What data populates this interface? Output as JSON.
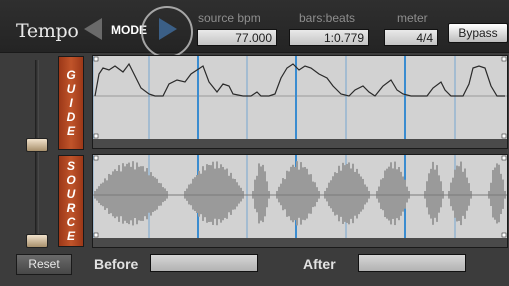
{
  "header": {
    "title": "Tempo",
    "mode_label": "MODE",
    "bypass_label": "Bypass"
  },
  "fields": {
    "source_bpm": {
      "label": "source bpm",
      "value": "77.000"
    },
    "bars_beats": {
      "label": "bars:beats",
      "value": "1:0.779"
    },
    "meter": {
      "label": "meter",
      "value": "4/4"
    }
  },
  "side_labels": {
    "guide": [
      "G",
      "U",
      "I",
      "D",
      "E"
    ],
    "source": [
      "S",
      "O",
      "U",
      "R",
      "C",
      "E"
    ]
  },
  "slider": {
    "upper_level": 0.55,
    "lower_level": 0.0
  },
  "footer": {
    "reset_label": "Reset",
    "before_label": "Before",
    "before_value": "",
    "after_label": "After",
    "after_value": ""
  },
  "colors": {
    "accent_blue": "#3b5f86",
    "side_label_orange": "#b84a22",
    "waveform_gray": "#9a9a9a",
    "beat_line": "#3a8cd0"
  }
}
